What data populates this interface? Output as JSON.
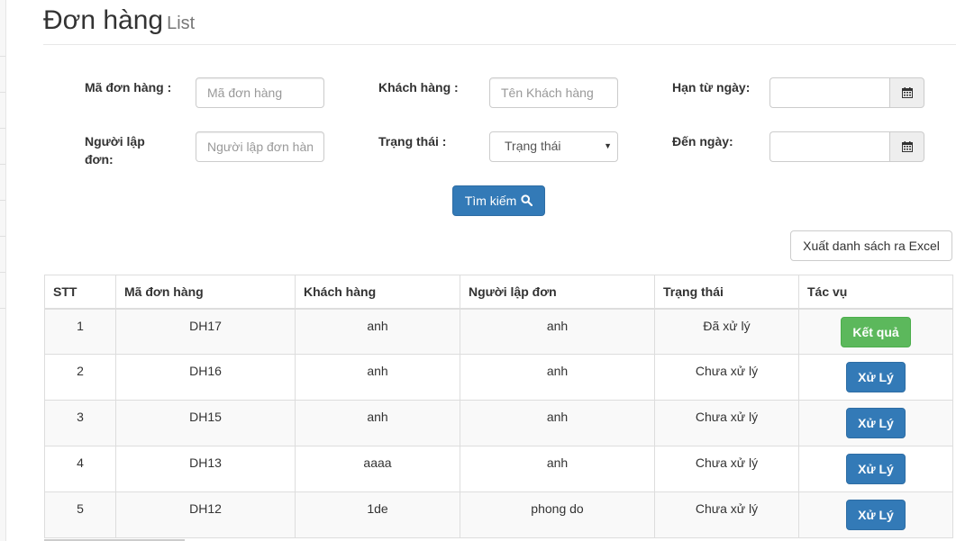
{
  "header": {
    "title": "Đơn hàng",
    "subtitle": "List"
  },
  "filters": {
    "order_code": {
      "label": "Mã đơn hàng :",
      "placeholder": "Mã đơn hàng"
    },
    "customer": {
      "label": "Khách hàng :",
      "placeholder": "Tên Khách hàng"
    },
    "from_date": {
      "label": "Hạn từ ngày:",
      "value": ""
    },
    "creator": {
      "label": "Người lập đơn:",
      "placeholder": "Người lập đơn hàng"
    },
    "status": {
      "label": "Trạng thái :",
      "selected": "Trạng thái"
    },
    "to_date": {
      "label": "Đến ngày:",
      "value": ""
    },
    "search_label": "Tìm kiếm",
    "calendar_icon": "calendar-icon",
    "search_icon": "search-icon"
  },
  "export_label": "Xuất danh sách ra Excel",
  "table": {
    "headers": [
      "STT",
      "Mã đơn hàng",
      "Khách hàng",
      "Người lập đơn",
      "Trạng thái",
      "Tác vụ"
    ],
    "rows": [
      {
        "stt": "1",
        "code": "DH17",
        "customer": "anh",
        "creator": "anh",
        "status": "Đã xử lý",
        "action": "Kết quả"
      },
      {
        "stt": "2",
        "code": "DH16",
        "customer": "anh",
        "creator": "anh",
        "status": "Chưa xử lý",
        "action": "Xử Lý"
      },
      {
        "stt": "3",
        "code": "DH15",
        "customer": "anh",
        "creator": "anh",
        "status": "Chưa xử lý",
        "action": "Xử Lý"
      },
      {
        "stt": "4",
        "code": "DH13",
        "customer": "aaaa",
        "creator": "anh",
        "status": "Chưa xử lý",
        "action": "Xử Lý"
      },
      {
        "stt": "5",
        "code": "DH12",
        "customer": "1de",
        "creator": "phong do",
        "status": "Chưa xử lý",
        "action": "Xử Lý"
      }
    ]
  },
  "colors": {
    "primary": "#337ab7",
    "success": "#5cb85c"
  }
}
